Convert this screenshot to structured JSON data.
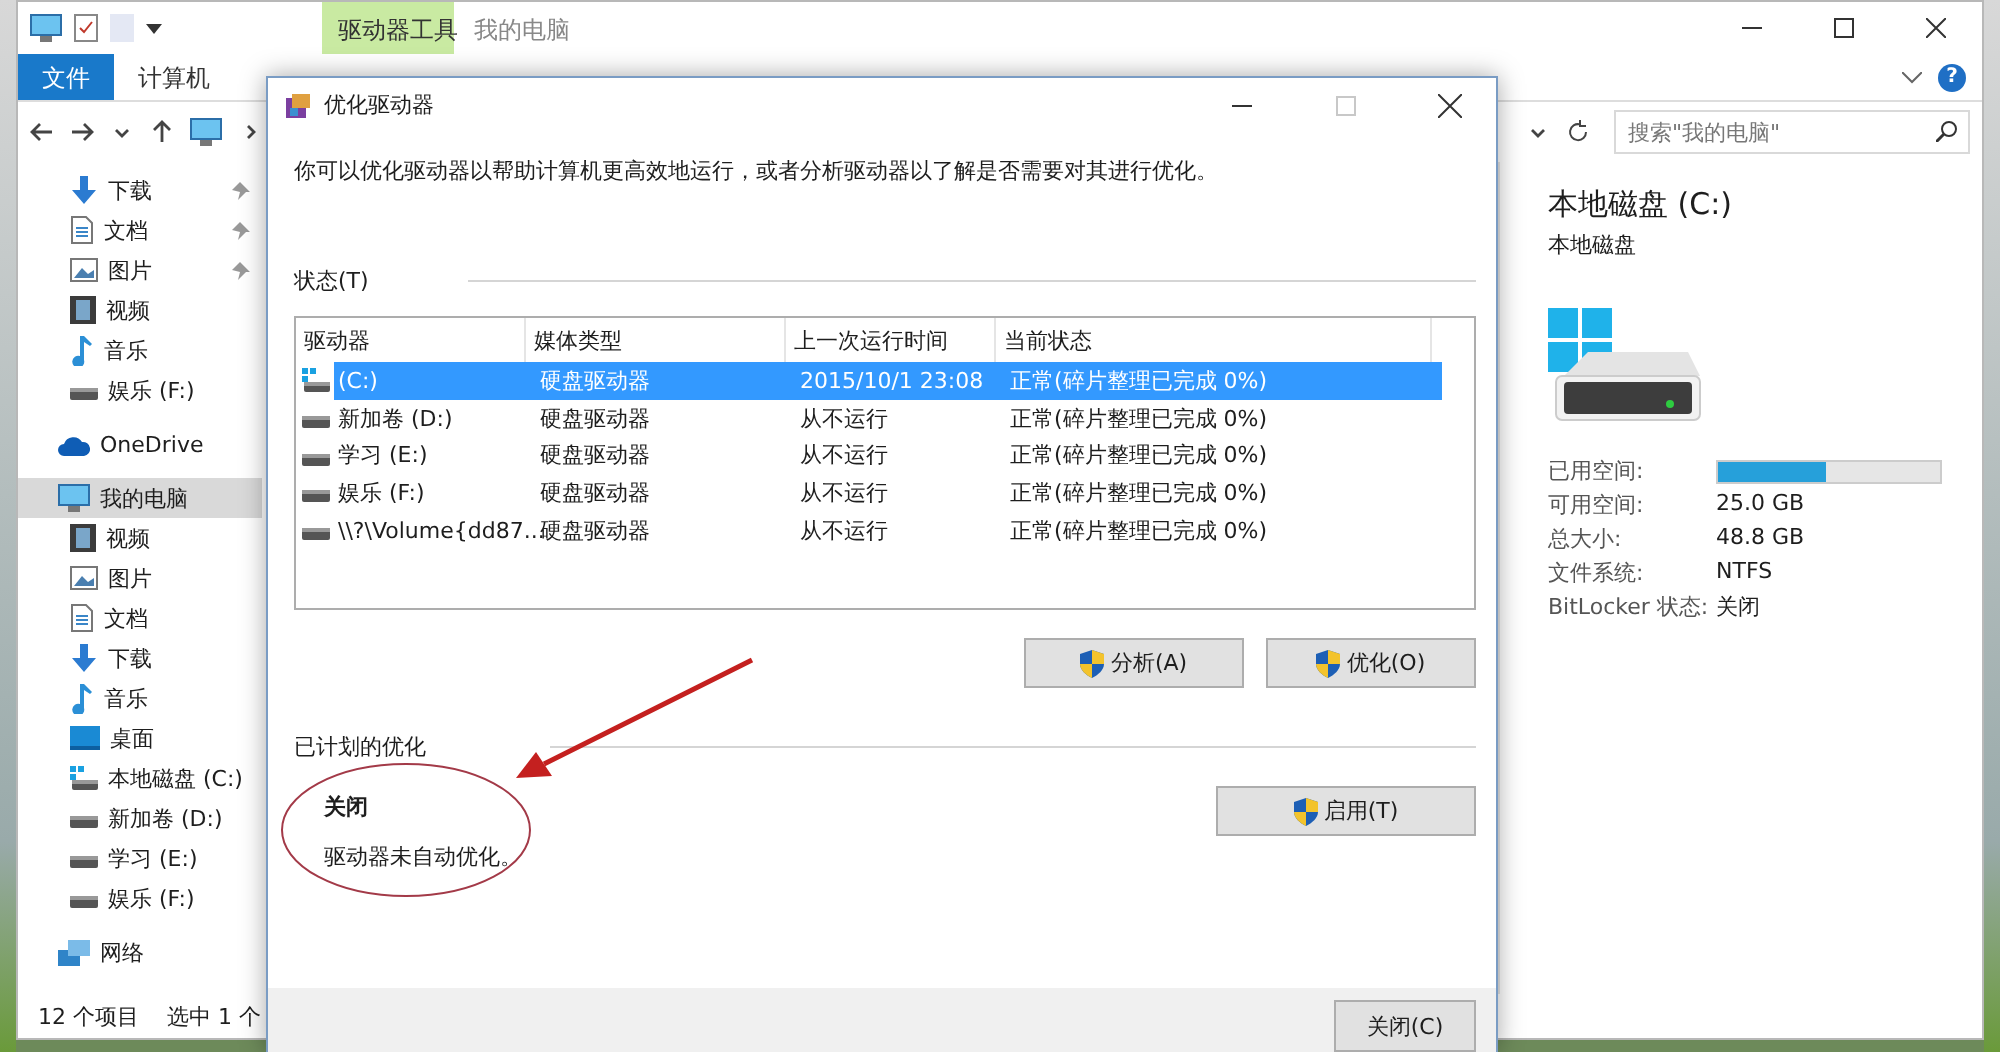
{
  "explorer": {
    "title": "我的电脑",
    "context_tab": "驱动器工具",
    "ribbon_tabs": [
      {
        "label": "文件",
        "selected": true
      },
      {
        "label": "计算机",
        "selected": false
      }
    ],
    "help": "?",
    "search": {
      "placeholder": "搜索\"我的电脑\""
    },
    "quick_access": [
      {
        "label": "下载",
        "kind": "download",
        "pinned": true,
        "selected": false
      },
      {
        "label": "文档",
        "kind": "document",
        "pinned": true,
        "selected": false
      },
      {
        "label": "图片",
        "kind": "picture",
        "pinned": true,
        "selected": false
      },
      {
        "label": "视频",
        "kind": "video",
        "pinned": false,
        "selected": false
      },
      {
        "label": "音乐",
        "kind": "music",
        "pinned": false,
        "selected": false
      },
      {
        "label": "娱乐 (F:)",
        "kind": "drive",
        "pinned": false,
        "selected": false
      }
    ],
    "nav_tree": [
      {
        "label": "OneDrive",
        "kind": "cloud",
        "selected": false
      },
      {
        "label": "我的电脑",
        "kind": "computer",
        "selected": true,
        "children": [
          {
            "label": "视频",
            "kind": "video",
            "selected": false
          },
          {
            "label": "图片",
            "kind": "picture",
            "selected": false
          },
          {
            "label": "文档",
            "kind": "document",
            "selected": false
          },
          {
            "label": "下载",
            "kind": "download",
            "selected": false
          },
          {
            "label": "音乐",
            "kind": "music",
            "selected": false
          },
          {
            "label": "桌面",
            "kind": "desktop",
            "selected": false
          },
          {
            "label": "本地磁盘 (C:)",
            "kind": "system",
            "selected": false
          },
          {
            "label": "新加卷 (D:)",
            "kind": "drive",
            "selected": false
          },
          {
            "label": "学习 (E:)",
            "kind": "drive",
            "selected": false
          },
          {
            "label": "娱乐 (F:)",
            "kind": "drive",
            "selected": false
          }
        ]
      },
      {
        "label": "网络",
        "kind": "network",
        "selected": false
      }
    ],
    "status_bar": [
      "12 个项目",
      "选中 1 个"
    ],
    "details": {
      "title": "本地磁盘 (C:)",
      "subtitle": "本地磁盘",
      "properties": [
        {
          "label": "已用空间:",
          "kind": "bar",
          "level": 0.49
        },
        {
          "label": "可用空间:",
          "kind": "text",
          "value": "25.0 GB"
        },
        {
          "label": "总大小:",
          "kind": "text",
          "value": "48.8 GB"
        },
        {
          "label": "文件系统:",
          "kind": "text",
          "value": "NTFS"
        },
        {
          "label": "BitLocker 状态:",
          "kind": "text",
          "value": "关闭"
        }
      ]
    }
  },
  "dialog": {
    "title": "优化驱动器",
    "maximize_disabled": true,
    "description": "你可以优化驱动器以帮助计算机更高效地运行，或者分析驱动器以了解是否需要对其进行优化。",
    "status_group": "状态(T)",
    "columns": [
      "驱动器",
      "媒体类型",
      "上一次运行时间",
      "当前状态"
    ],
    "rows": [
      {
        "drive": "(C:)",
        "kind": "system",
        "media_type": "硬盘驱动器",
        "last_run": "2015/10/1 23:08",
        "status": "正常(碎片整理已完成 0%)",
        "selected": true
      },
      {
        "drive": "新加卷 (D:)",
        "kind": "drive",
        "media_type": "硬盘驱动器",
        "last_run": "从不运行",
        "status": "正常(碎片整理已完成 0%)",
        "selected": false
      },
      {
        "drive": "学习 (E:)",
        "kind": "drive",
        "media_type": "硬盘驱动器",
        "last_run": "从不运行",
        "status": "正常(碎片整理已完成 0%)",
        "selected": false
      },
      {
        "drive": "娱乐 (F:)",
        "kind": "drive",
        "media_type": "硬盘驱动器",
        "last_run": "从不运行",
        "status": "正常(碎片整理已完成 0%)",
        "selected": false
      },
      {
        "drive": "\\\\?\\Volume{dd87...",
        "kind": "drive",
        "media_type": "硬盘驱动器",
        "last_run": "从不运行",
        "status": "正常(碎片整理已完成 0%)",
        "selected": false
      }
    ],
    "actions": [
      "分析(A)",
      "优化(O)"
    ],
    "schedule_group": "已计划的优化",
    "schedule_state": "关闭",
    "schedule_note": "驱动器未自动优化。",
    "enable_button": "启用(T)",
    "close_button": "关闭(C)"
  }
}
